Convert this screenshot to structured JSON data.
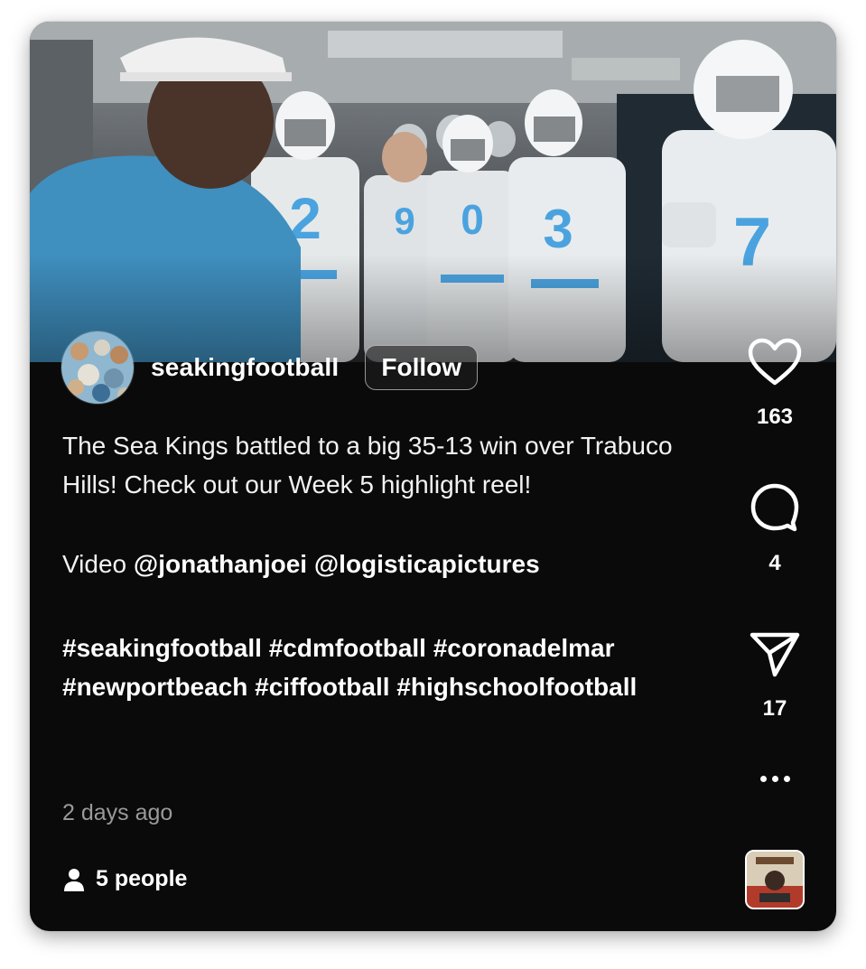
{
  "post": {
    "username": "seakingfootball",
    "follow_label": "Follow",
    "caption_line1": "The Sea Kings battled to a big 35-13 win over Trabuco Hills! Check out our Week 5 highlight reel!",
    "credit_prefix": "Video ",
    "credit_mention1": "@jonathanjoei",
    "credit_mention2": "@logisticapictures",
    "hashtags": "#seakingfootball #cdmfootball #coronadelmar #newportbeach #ciffootball #highschoolfootball",
    "timestamp": "2 days ago",
    "viewers": "5 people"
  },
  "video": {
    "jersey_numbers": [
      "2",
      "9",
      "0",
      "3",
      "7"
    ]
  },
  "actions": {
    "likes": "163",
    "comments": "4",
    "shares": "17"
  },
  "icons": {
    "like": "heart-icon",
    "comment": "comment-bubble-icon",
    "share": "paper-plane-icon",
    "more": "more-dots-icon",
    "viewers": "person-icon"
  },
  "colors": {
    "background": "#0a0a0a",
    "text": "#ffffff",
    "muted": "#9a9a9a",
    "jersey_accent": "#4aa3df"
  }
}
